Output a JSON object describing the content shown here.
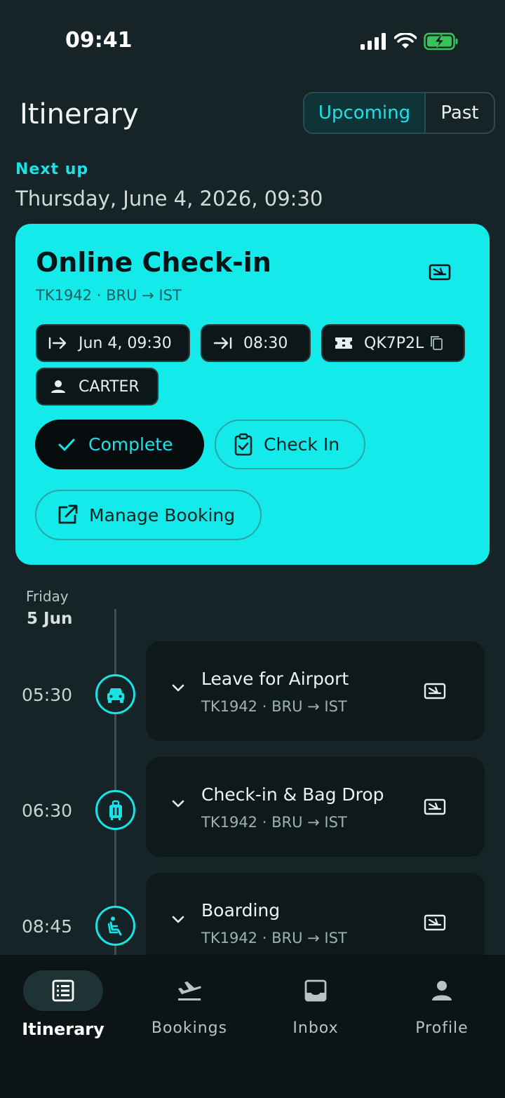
{
  "status_bar": {
    "time": "09:41",
    "icons": [
      "signal-icon",
      "wifi-icon",
      "battery-charging-icon"
    ]
  },
  "header": {
    "title": "Itinerary",
    "segments": {
      "upcoming": "Upcoming",
      "past": "Past"
    }
  },
  "next_up": {
    "label": "Next up",
    "date": "Thursday, June 4, 2026, 09:30",
    "card": {
      "title": "Online Check-in",
      "subtitle": "TK1942 · BRU → IST",
      "chips": {
        "opens": "Jun 4, 09:30",
        "closes": "08:30",
        "booking_ref": "QK7P2L",
        "passenger": "CARTER"
      },
      "buttons": {
        "complete": "Complete",
        "check_in": "Check In",
        "manage": "Manage Booking"
      }
    }
  },
  "timeline": {
    "day_name": "Friday",
    "day_date": "5 Jun",
    "events": [
      {
        "time": "05:30",
        "title": "Leave for Airport",
        "subtitle": "TK1942 · BRU → IST",
        "icon": "car-icon"
      },
      {
        "time": "06:30",
        "title": "Check-in & Bag Drop",
        "subtitle": "TK1942 · BRU → IST",
        "icon": "luggage-icon"
      },
      {
        "time": "08:45",
        "title": "Boarding",
        "subtitle": "TK1942 · BRU → IST",
        "icon": "boarding-icon"
      }
    ]
  },
  "bottom_nav": {
    "items": [
      {
        "label": "Itinerary",
        "icon": "list-icon",
        "active": true
      },
      {
        "label": "Bookings",
        "icon": "flight-icon",
        "active": false
      },
      {
        "label": "Inbox",
        "icon": "inbox-icon",
        "active": false
      },
      {
        "label": "Profile",
        "icon": "person-icon",
        "active": false
      }
    ]
  },
  "colors": {
    "accent": "#19e3e6",
    "card": "#15eaeb",
    "background": "#162427",
    "nav": "#0c1415"
  }
}
